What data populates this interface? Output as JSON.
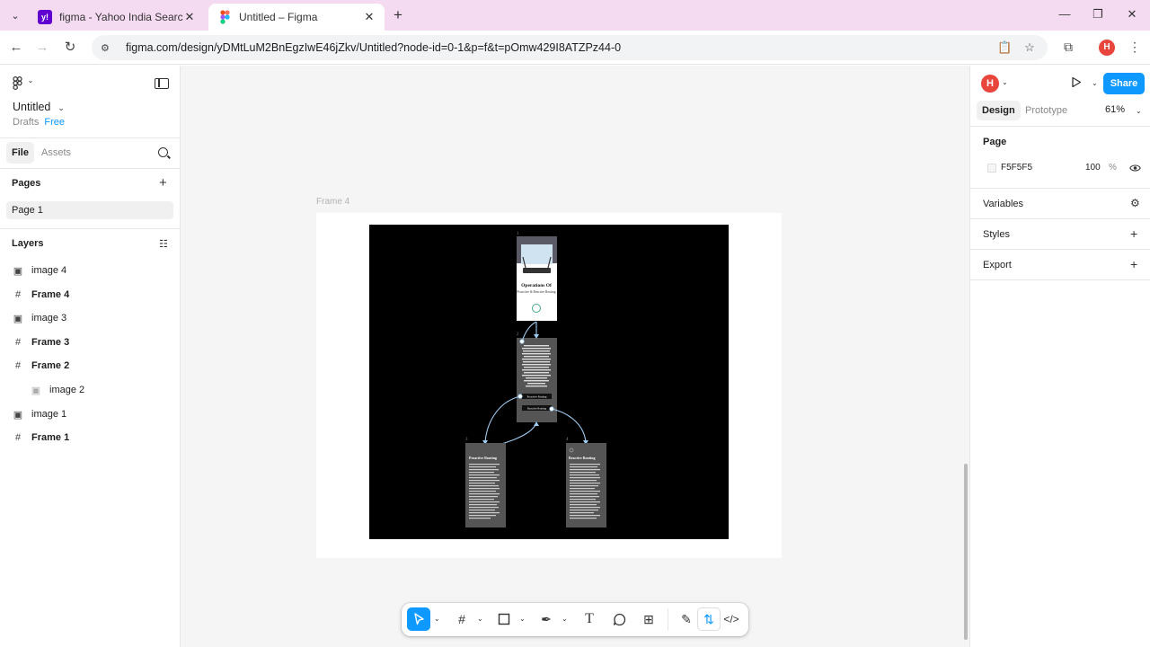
{
  "browser": {
    "tabs": [
      {
        "title": "figma - Yahoo India Search Res",
        "favicon": "yahoo-favicon"
      },
      {
        "title": "Untitled – Figma",
        "favicon": "figma-favicon"
      }
    ],
    "url": "figma.com/design/yDMtLuM2BnEgzIwE46jZkv/Untitled?node-id=0-1&p=f&t=pOmw429I8ATZPz44-0"
  },
  "left_panel": {
    "file_name": "Untitled",
    "location": "Drafts",
    "plan": "Free",
    "tabs": [
      "File",
      "Assets"
    ],
    "pages_header": "Pages",
    "pages": [
      "Page 1"
    ],
    "layers_header": "Layers",
    "layers": [
      {
        "name": "image 4",
        "type": "image"
      },
      {
        "name": "Frame 4",
        "type": "frame"
      },
      {
        "name": "image 3",
        "type": "image"
      },
      {
        "name": "Frame 3",
        "type": "frame"
      },
      {
        "name": "Frame 2",
        "type": "frame"
      },
      {
        "name": "image 2",
        "type": "image-child"
      },
      {
        "name": "image 1",
        "type": "image"
      },
      {
        "name": "Frame 1",
        "type": "frame"
      }
    ]
  },
  "canvas": {
    "frame_label": "Frame 4",
    "image_texts": {
      "num1": "1",
      "num2": "2",
      "num3": "3",
      "num4": "4",
      "card1_title": "Operations Of",
      "card1_sub": "Proactive & Reactive Routing",
      "btn_proactive": "Proactive Routing",
      "btn_reactive": "Reactive Routing",
      "card3_title": "Proactive Routing",
      "card4_title": "Reactive Routing"
    }
  },
  "right_panel": {
    "avatar": "H",
    "share_label": "Share",
    "tabs": [
      "Design",
      "Prototype"
    ],
    "zoom": "61%",
    "page_section": "Page",
    "page_color": "F5F5F5",
    "page_opacity": "100",
    "page_opacity_unit": "%",
    "sections": [
      "Variables",
      "Styles",
      "Export"
    ]
  },
  "toolbar": {
    "help": "?"
  },
  "colors": {
    "accent": "#0d99ff",
    "tab_strip": "#f5dbf1",
    "canvas": "#f5f5f5"
  }
}
